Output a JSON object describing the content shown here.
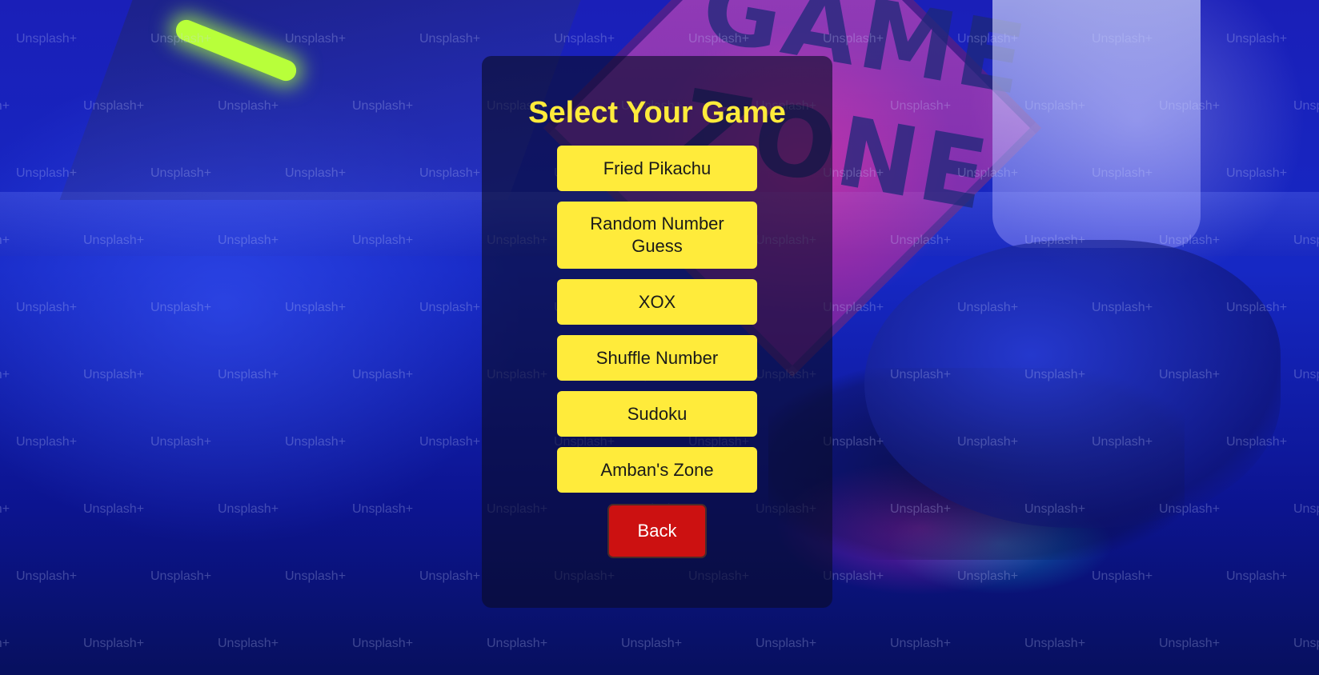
{
  "page": {
    "title": "Select Your Game"
  },
  "games": [
    {
      "label": "Fried Pikachu"
    },
    {
      "label": "Random Number Guess"
    },
    {
      "label": "XOX"
    },
    {
      "label": "Shuffle Number"
    },
    {
      "label": "Sudoku"
    },
    {
      "label": "Amban's Zone"
    }
  ],
  "back_button": {
    "label": "Back"
  },
  "background": {
    "watermark_text": "Unsplash+",
    "sign_text": "GAME ZONE"
  },
  "colors": {
    "title": "#ffeb3b",
    "game_button": "#ffeb3b",
    "back_button": "#cc1111"
  }
}
